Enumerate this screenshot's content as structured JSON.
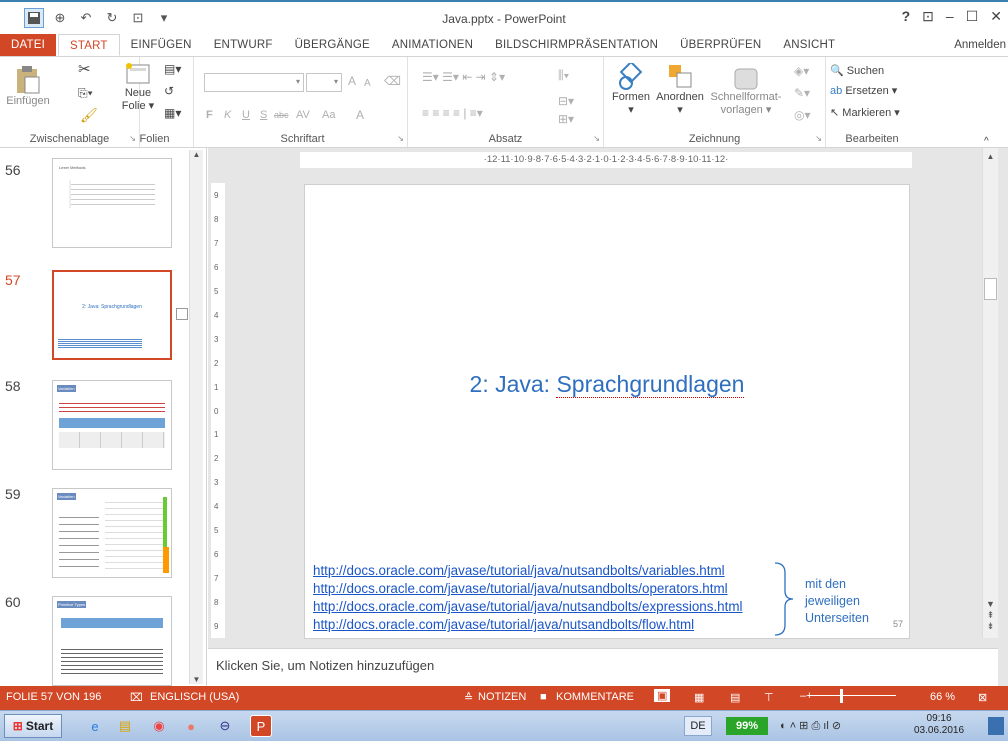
{
  "window": {
    "title": "Java.pptx - PowerPoint",
    "help": "?",
    "signin": "Anmelden"
  },
  "qat": {
    "save_icon": "save-icon",
    "zoom_icon": "zoom-icon",
    "undo_icon": "undo-icon",
    "redo_icon": "redo-icon",
    "present_icon": "present-icon",
    "more": "▾"
  },
  "tabs": [
    "DATEI",
    "START",
    "EINFÜGEN",
    "ENTWURF",
    "ÜBERGÄNGE",
    "ANIMATIONEN",
    "BILDSCHIRMPRÄSENTATION",
    "ÜBERPRÜFEN",
    "ANSICHT"
  ],
  "ribbon": {
    "clipboard": {
      "label": "Zwischenablage",
      "paste": "Einfügen"
    },
    "slides": {
      "label": "Folien",
      "new_slide": "Neue",
      "new_slide2": "Folie"
    },
    "font": {
      "label": "Schriftart",
      "bold": "F",
      "italic": "K",
      "underline": "U",
      "shadow": "S",
      "strike": "abc",
      "spacing": "AV",
      "case": "Aa",
      "color": "A",
      "grow": "A",
      "shrink": "A"
    },
    "paragraph": {
      "label": "Absatz"
    },
    "drawing": {
      "label": "Zeichnung",
      "shapes": "Formen",
      "arrange": "Anordnen",
      "quick": "Schnellformat-",
      "quick2": "vorlagen"
    },
    "editing": {
      "label": "Bearbeiten",
      "find": "Suchen",
      "replace": "Ersetzen",
      "select": "Markieren"
    }
  },
  "thumbnails": [
    {
      "num": "56",
      "title": "Lexer Methods"
    },
    {
      "num": "57",
      "title": "2: Java: Sprachgrundlagen"
    },
    {
      "num": "58",
      "title": "Variablen"
    },
    {
      "num": "59",
      "title": "Variablen"
    },
    {
      "num": "60",
      "title": "Primitive Typen"
    }
  ],
  "ruler_h": "·12·11·10·9·8·7·6·5·4·3·2·1·0·1·2·3·4·5·6·7·8·9·10·11·12·",
  "ruler_v": [
    "9",
    "8",
    "7",
    "6",
    "5",
    "4",
    "3",
    "2",
    "1",
    "0",
    "1",
    "2",
    "3",
    "4",
    "5",
    "6",
    "7",
    "8",
    "9"
  ],
  "slide": {
    "title_a": "2: Java: ",
    "title_b": "Sprachgrundlagen",
    "links": [
      "http://docs.oracle.com/javase/tutorial/java/nutsandbolts/variables.html",
      "http://docs.oracle.com/javase/tutorial/java/nutsandbolts/operators.html",
      "http://docs.oracle.com/javase/tutorial/java/nutsandbolts/expressions.html",
      "http://docs.oracle.com/javase/tutorial/java/nutsandbolts/flow.html"
    ],
    "side_note": [
      "mit den",
      "jeweiligen",
      "Unterseiten"
    ],
    "number": "57"
  },
  "notes_placeholder": "Klicken Sie, um Notizen hinzuzufügen",
  "status": {
    "slide": "FOLIE 57 VON 196",
    "lang": "ENGLISCH (USA)",
    "notes": "NOTIZEN",
    "comments": "KOMMENTARE",
    "zoom": "66 %"
  },
  "taskbar": {
    "start": "Start",
    "lang": "DE",
    "battery": "99%",
    "time": "09:16",
    "date": "03.06.2016"
  },
  "colors": {
    "accent": "#d24726",
    "link": "#1b56c8",
    "title": "#2e6fbf"
  }
}
